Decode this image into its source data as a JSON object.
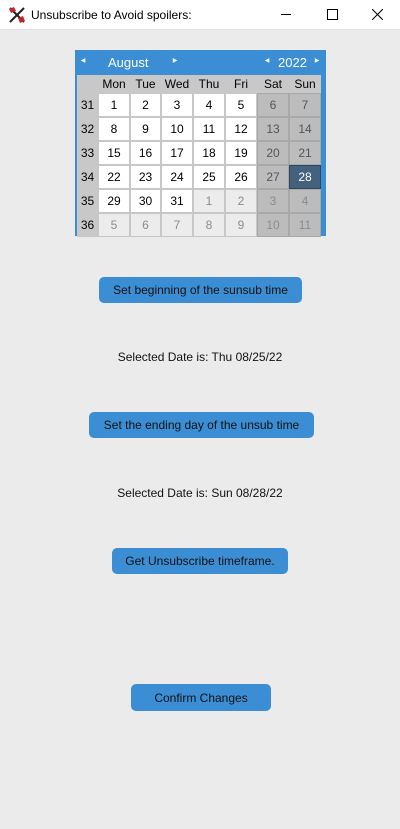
{
  "window": {
    "title": "Unsubscribe to Avoid spoilers:"
  },
  "calendar": {
    "month": "August",
    "year": "2022",
    "weekdays": [
      "Mon",
      "Tue",
      "Wed",
      "Thu",
      "Fri",
      "Sat",
      "Sun"
    ],
    "weeks": [
      {
        "num": "31",
        "days": [
          "1",
          "2",
          "3",
          "4",
          "5",
          "6",
          "7"
        ]
      },
      {
        "num": "32",
        "days": [
          "8",
          "9",
          "10",
          "11",
          "12",
          "13",
          "14"
        ]
      },
      {
        "num": "33",
        "days": [
          "15",
          "16",
          "17",
          "18",
          "19",
          "20",
          "21"
        ]
      },
      {
        "num": "34",
        "days": [
          "22",
          "23",
          "24",
          "25",
          "26",
          "27",
          "28"
        ]
      },
      {
        "num": "35",
        "days": [
          "29",
          "30",
          "31",
          "1",
          "2",
          "3",
          "4"
        ]
      },
      {
        "num": "36",
        "days": [
          "5",
          "6",
          "7",
          "8",
          "9",
          "10",
          "11"
        ]
      }
    ],
    "selected_day": "28",
    "colors": {
      "header": "#3b8ed4",
      "selected": "#44617e",
      "weekend": "#bcbcbc"
    }
  },
  "buttons": {
    "set_begin": "Set beginning of the sunsub time",
    "set_end": "Set the ending day of the unsub time",
    "get_timeframe": "Get Unsubscribe timeframe.",
    "confirm": "Confirm Changes"
  },
  "selected": {
    "begin_label": "Selected Date is:  Thu 08/25/22",
    "end_label": "Selected Date is:  Sun 08/28/22"
  }
}
